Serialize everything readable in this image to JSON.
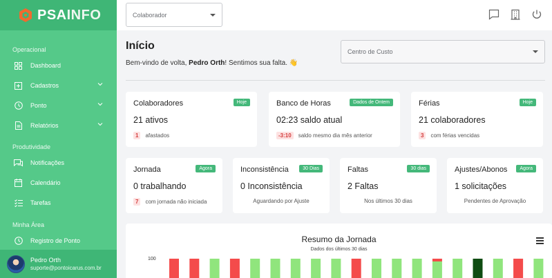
{
  "brand": {
    "name_bold": "PSA",
    "name_rest": "INFO",
    "logo_color": "#f26a2e"
  },
  "sidebar": {
    "sections": [
      {
        "title": "Operacional"
      },
      {
        "title": "Produtividade"
      },
      {
        "title": "Minha Área"
      }
    ],
    "items": [
      {
        "label": "Dashboard",
        "icon": "dashboard-icon"
      },
      {
        "label": "Cadastros",
        "icon": "plus-square-icon",
        "expandable": true
      },
      {
        "label": "Ponto",
        "icon": "clock-icon",
        "expandable": true
      },
      {
        "label": "Relatórios",
        "icon": "document-icon",
        "expandable": true
      },
      {
        "label": "Notificações",
        "icon": "chat-icon"
      },
      {
        "label": "Calendário",
        "icon": "calendar-icon"
      },
      {
        "label": "Tarefas",
        "icon": "tasks-icon"
      },
      {
        "label": "Registro de Ponto",
        "icon": "clock-icon"
      }
    ],
    "user": {
      "name": "Pedro Orth",
      "email": "suporte@pontoicarus.com.br"
    }
  },
  "topbar": {
    "colaborador_placeholder": "Colaborador",
    "icons": [
      "message-icon",
      "building-icon",
      "power-icon"
    ]
  },
  "page": {
    "title": "Início",
    "welcome_prefix": "Bem-vindo de volta, ",
    "welcome_name": "Pedro Orth",
    "welcome_suffix": "! Sentimos sua falta. 👋",
    "centro_custo_placeholder": "Centro de Custo"
  },
  "cards_row1": [
    {
      "title": "Colaboradores",
      "badge": "Hoje",
      "value": "21 ativos",
      "foot_pill": "1",
      "foot_text": "afastados"
    },
    {
      "title": "Banco de Horas",
      "badge": "Dados de Ontem",
      "value": "02:23 saldo atual",
      "foot_pill": "-3:10",
      "foot_text": "saldo mesmo dia mês anterior"
    },
    {
      "title": "Férias",
      "badge": "Hoje",
      "value": "21 colaboradores",
      "foot_pill": "3",
      "foot_text": "com férias vencidas"
    }
  ],
  "cards_row2": [
    {
      "title": "Jornada",
      "badge": "Agora",
      "value": "0 trabalhando",
      "foot_pill": "7",
      "foot_text": "com jornada não iniciada"
    },
    {
      "title": "Inconsistência",
      "badge": "30 Dias",
      "value": "0 Inconsistência",
      "foot_text": "Aguardando por Ajuste"
    },
    {
      "title": "Faltas",
      "badge": "30 dias",
      "value": "2 Faltas",
      "foot_text": "Nos últimos 30 dias"
    },
    {
      "title": "Ajustes/Abonos",
      "badge": "Agora",
      "value": "1 solicitações",
      "foot_text": "Pendentes de Aprovação"
    }
  ],
  "colors": {
    "accent": "#55c989",
    "accent_dark": "#3fb676",
    "badge": "#44b87a",
    "bar_green": "#90e57d",
    "bar_red": "#f44b4b",
    "bar_dark": "#0f4c12"
  },
  "chart_data": {
    "type": "bar",
    "title": "Resumo da Jornada",
    "subtitle": "Dados dos últimos 30 dias",
    "ytick_top": "100",
    "series": [
      {
        "values": [
          100,
          100,
          100,
          100,
          100,
          100,
          100,
          100,
          100,
          100,
          100,
          100,
          100,
          100,
          100,
          100,
          100,
          100,
          100
        ],
        "colors": [
          "red",
          "red",
          "green",
          "red",
          "green",
          "green",
          "green",
          "green",
          "green",
          "red",
          "green",
          "green",
          "green",
          "mixed",
          "green",
          "dark",
          "green",
          "red",
          "green"
        ]
      }
    ]
  }
}
